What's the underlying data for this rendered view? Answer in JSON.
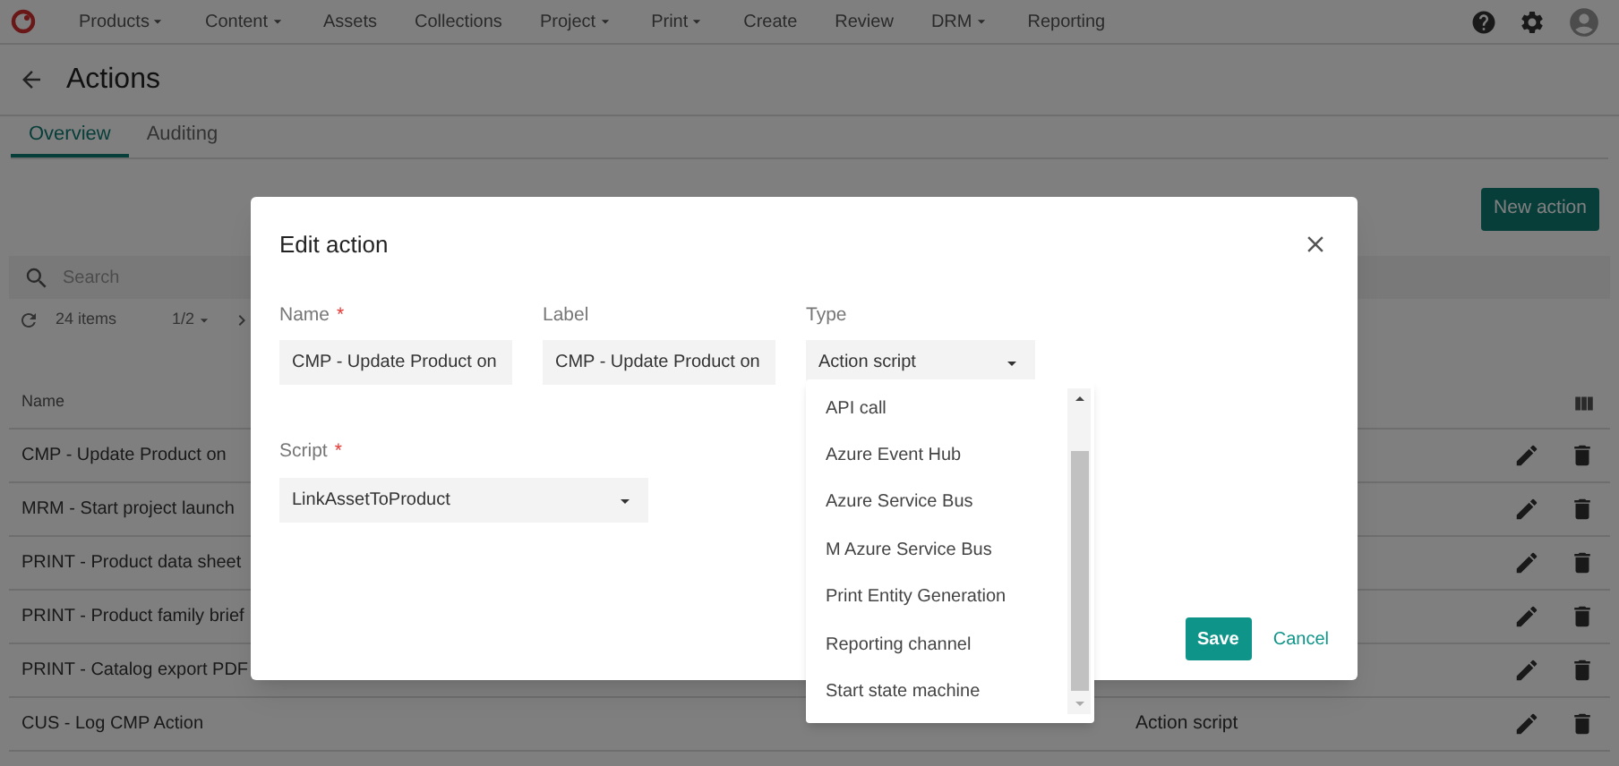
{
  "nav": {
    "items": [
      {
        "label": "Products",
        "dropdown": true
      },
      {
        "label": "Content",
        "dropdown": true
      },
      {
        "label": "Assets",
        "dropdown": false
      },
      {
        "label": "Collections",
        "dropdown": false
      },
      {
        "label": "Project",
        "dropdown": true
      },
      {
        "label": "Print",
        "dropdown": true
      },
      {
        "label": "Create",
        "dropdown": false
      },
      {
        "label": "Review",
        "dropdown": false
      },
      {
        "label": "DRM",
        "dropdown": true
      },
      {
        "label": "Reporting",
        "dropdown": false
      }
    ]
  },
  "page": {
    "title": "Actions"
  },
  "tabs": [
    {
      "label": "Overview",
      "selected": true
    },
    {
      "label": "Auditing",
      "selected": false
    }
  ],
  "new_action_button": "New action",
  "search": {
    "placeholder": "Search"
  },
  "toolbar": {
    "count": "24 items",
    "pages": "1/2"
  },
  "table": {
    "columns": [
      "Name"
    ],
    "rows": [
      {
        "name": "CMP - Update Product on",
        "type": ""
      },
      {
        "name": "MRM - Start project launch",
        "type": ""
      },
      {
        "name": "PRINT - Product data sheet",
        "type": ""
      },
      {
        "name": "PRINT - Product family brief",
        "type": ""
      },
      {
        "name": "PRINT - Catalog export PDF",
        "type": ""
      },
      {
        "name": "CUS - Log CMP Action",
        "type": "Action script"
      }
    ]
  },
  "dialog": {
    "title": "Edit action",
    "fields": [
      {
        "label": "Name",
        "required_mark": "*",
        "value": "CMP - Update Product on",
        "kind": "text"
      },
      {
        "label": "Label",
        "value": "CMP - Update Product on",
        "kind": "text"
      },
      {
        "label": "Type",
        "value": "Action script",
        "kind": "select"
      }
    ],
    "script": {
      "label": "Script",
      "required_mark": "*",
      "value": "LinkAssetToProduct"
    },
    "save": "Save",
    "cancel": "Cancel"
  },
  "type_menu": {
    "options": [
      "API call",
      "Azure Event Hub",
      "Azure Service Bus",
      "M Azure Service Bus",
      "Print Entity Generation",
      "Reporting channel",
      "Start state machine"
    ]
  }
}
